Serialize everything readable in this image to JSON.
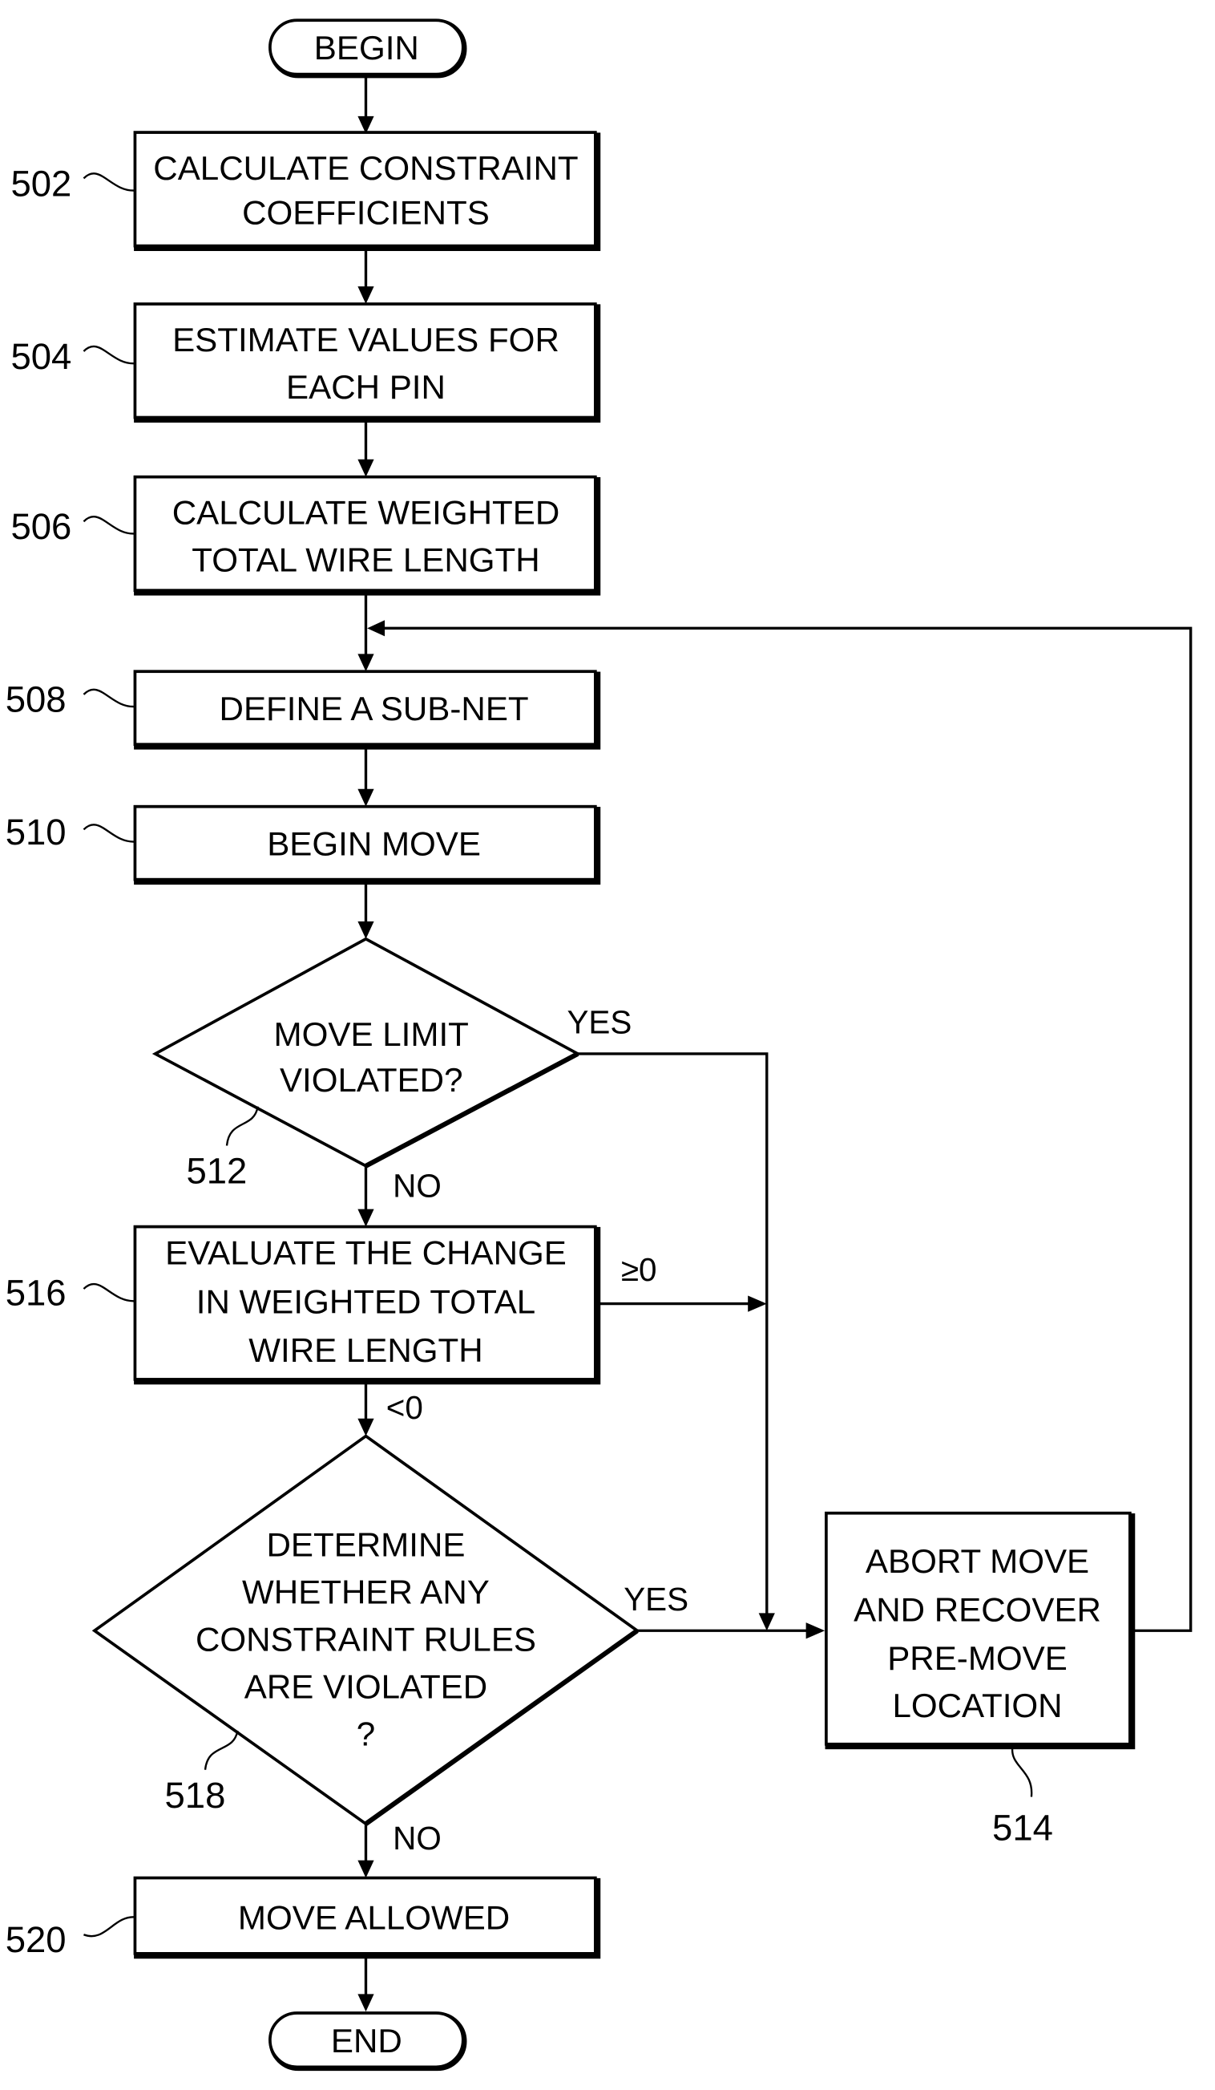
{
  "terminals": {
    "begin": "BEGIN",
    "end": "END"
  },
  "steps": {
    "s502": {
      "ref": "502",
      "lines": [
        "CALCULATE CONSTRAINT",
        "COEFFICIENTS"
      ]
    },
    "s504": {
      "ref": "504",
      "lines": [
        "ESTIMATE VALUES FOR",
        "EACH PIN"
      ]
    },
    "s506": {
      "ref": "506",
      "lines": [
        "CALCULATE WEIGHTED",
        "TOTAL WIRE LENGTH"
      ]
    },
    "s508": {
      "ref": "508",
      "lines": [
        "DEFINE A SUB-NET"
      ]
    },
    "s510": {
      "ref": "510",
      "lines": [
        "BEGIN MOVE"
      ]
    },
    "s512": {
      "ref": "512",
      "lines": [
        "MOVE LIMIT",
        "VIOLATED?"
      ]
    },
    "s514": {
      "ref": "514",
      "lines": [
        "ABORT MOVE",
        "AND RECOVER",
        "PRE-MOVE",
        "LOCATION"
      ]
    },
    "s516": {
      "ref": "516",
      "lines": [
        "EVALUATE THE CHANGE",
        "IN WEIGHTED TOTAL",
        "WIRE LENGTH"
      ]
    },
    "s518": {
      "ref": "518",
      "lines": [
        "DETERMINE",
        "WHETHER ANY",
        "CONSTRAINT RULES",
        "ARE VIOLATED",
        "?"
      ]
    },
    "s520": {
      "ref": "520",
      "lines": [
        "MOVE ALLOWED"
      ]
    }
  },
  "branch_labels": {
    "d512_yes": "YES",
    "d512_no": "NO",
    "s516_ge0": "≥0",
    "s516_lt0": "<0",
    "d518_yes": "YES",
    "d518_no": "NO"
  }
}
